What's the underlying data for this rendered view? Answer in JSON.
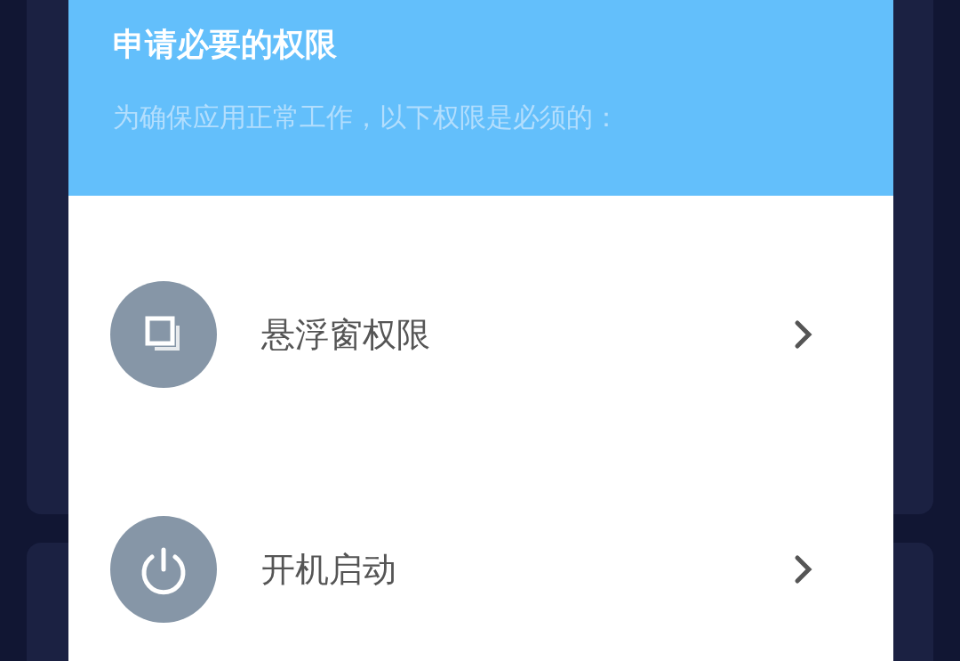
{
  "dialog": {
    "title": "申请必要的权限",
    "subtitle": "为确保应用正常工作，以下权限是必须的：",
    "items": [
      {
        "label": "悬浮窗权限",
        "kind": "windows"
      },
      {
        "label": "开机启动",
        "kind": "power"
      }
    ]
  }
}
